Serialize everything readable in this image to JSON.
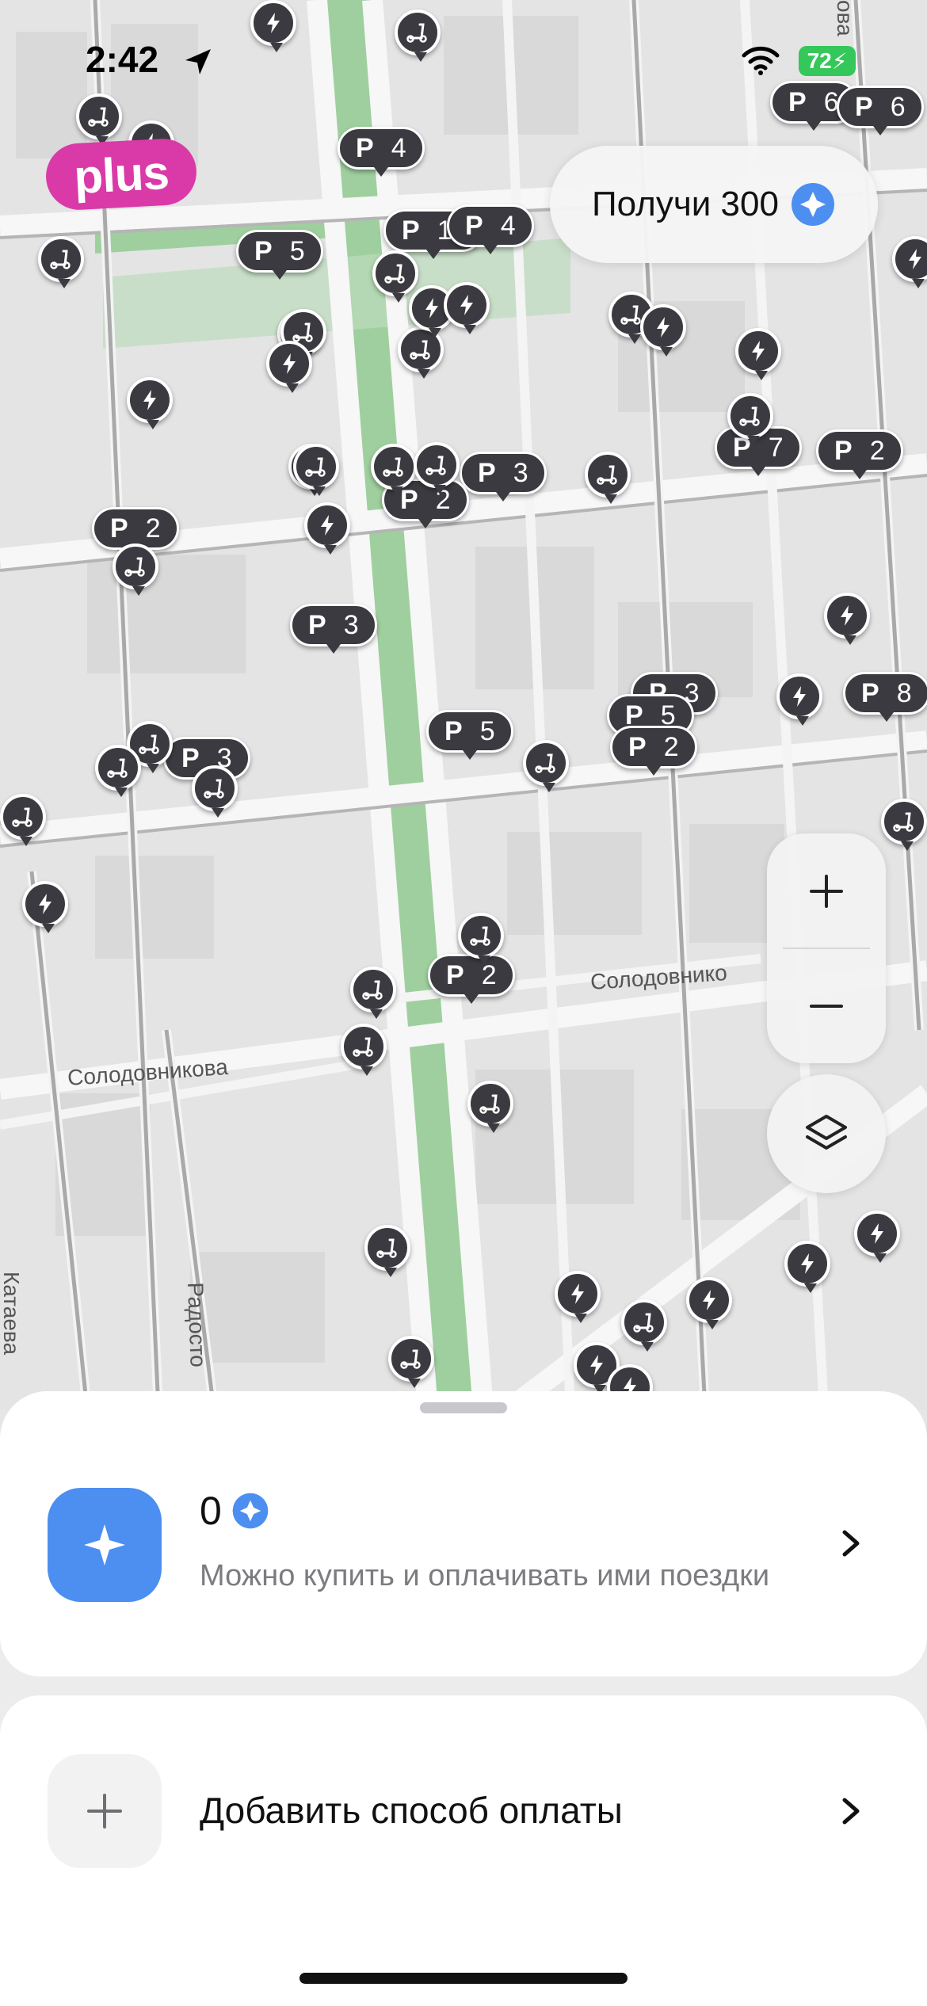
{
  "status_bar": {
    "time": "2:42",
    "battery": "72"
  },
  "brand": {
    "badge": "plus"
  },
  "promo": {
    "label": "Получи 300"
  },
  "map": {
    "streets": [
      "Солодовникова",
      "Солодовнико",
      "Катаева",
      "Радосто",
      "ова"
    ],
    "parking": [
      {
        "p": "P",
        "count": "4"
      },
      {
        "p": "P",
        "count": "5"
      },
      {
        "p": "P",
        "count": "11"
      },
      {
        "p": "P",
        "count": "4"
      },
      {
        "p": "P",
        "count": "6"
      },
      {
        "p": "P",
        "count": "6"
      },
      {
        "p": "P",
        "count": "7"
      },
      {
        "p": "P",
        "count": "2"
      },
      {
        "p": "P",
        "count": "3"
      },
      {
        "p": "P",
        "count": "2"
      },
      {
        "p": "P",
        "count": "2"
      },
      {
        "p": "P",
        "count": "3"
      },
      {
        "p": "P",
        "count": "5"
      },
      {
        "p": "P",
        "count": "3"
      },
      {
        "p": "P",
        "count": "5"
      },
      {
        "p": "P",
        "count": "2"
      },
      {
        "p": "P",
        "count": "8"
      },
      {
        "p": "P",
        "count": "3"
      },
      {
        "p": "P",
        "count": "2"
      }
    ]
  },
  "controls": {
    "zoom_in": "+",
    "zoom_out": "−"
  },
  "balance": {
    "amount": "0",
    "description": "Можно купить и оплачивать ими поездки"
  },
  "payment": {
    "add_label": "Добавить способ оплаты"
  },
  "colors": {
    "accent": "#4c8ff0",
    "brand": "#d93aa8",
    "marker": "#3a3a40",
    "battery": "#34c759"
  }
}
